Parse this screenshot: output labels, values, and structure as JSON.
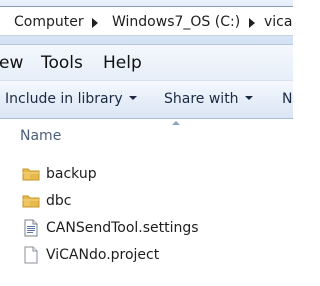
{
  "address_bar": {
    "crumbs": [
      "Computer",
      "Windows7_OS (C:)",
      "vica"
    ]
  },
  "menu": {
    "items": [
      "ew",
      "Tools",
      "Help"
    ]
  },
  "toolbar": {
    "include_label": "Include in library",
    "share_label": "Share with",
    "new_label": "N"
  },
  "file_list": {
    "column_name": "Name",
    "items": [
      {
        "name": "backup",
        "type": "folder",
        "icon": "folder-icon"
      },
      {
        "name": "dbc",
        "type": "folder",
        "icon": "folder-icon"
      },
      {
        "name": "CANSendTool.settings",
        "type": "settings-file",
        "icon": "settings-file-icon"
      },
      {
        "name": "ViCANdo.project",
        "type": "file",
        "icon": "blank-file-icon"
      }
    ]
  },
  "colors": {
    "folder": "#e6b94a",
    "folder_dark": "#c9962a",
    "toolbar_text": "#1b2a43"
  }
}
